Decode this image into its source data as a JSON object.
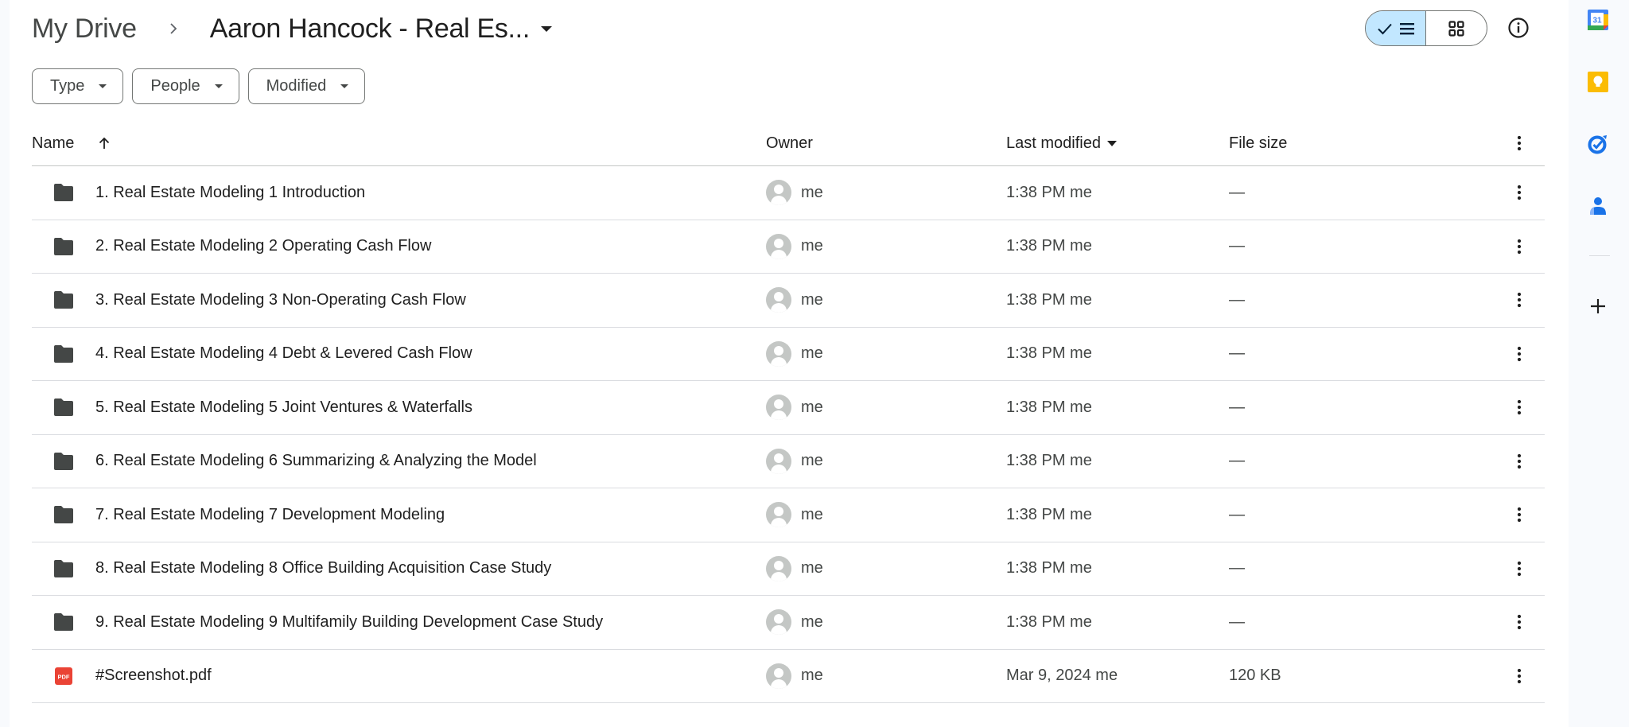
{
  "breadcrumb": {
    "root": "My Drive",
    "current": "Aaron Hancock - Real Es..."
  },
  "view_toggle": {
    "selected": "list",
    "options": [
      "list",
      "grid"
    ]
  },
  "filters": [
    {
      "label": "Type"
    },
    {
      "label": "People"
    },
    {
      "label": "Modified"
    }
  ],
  "table": {
    "columns": {
      "name": "Name",
      "owner": "Owner",
      "last_modified": "Last modified",
      "file_size": "File size"
    },
    "sort": {
      "column": "name",
      "direction": "ascending"
    },
    "rows": [
      {
        "type": "folder",
        "name": "1. Real Estate Modeling 1 Introduction",
        "owner": "me",
        "modified": "1:38 PM me",
        "size": "—"
      },
      {
        "type": "folder",
        "name": "2. Real Estate Modeling 2 Operating Cash Flow",
        "owner": "me",
        "modified": "1:38 PM me",
        "size": "—"
      },
      {
        "type": "folder",
        "name": "3. Real Estate Modeling 3 Non-Operating Cash Flow",
        "owner": "me",
        "modified": "1:38 PM me",
        "size": "—"
      },
      {
        "type": "folder",
        "name": "4. Real Estate Modeling 4 Debt & Levered Cash Flow",
        "owner": "me",
        "modified": "1:38 PM me",
        "size": "—"
      },
      {
        "type": "folder",
        "name": "5. Real Estate Modeling 5 Joint Ventures & Waterfalls",
        "owner": "me",
        "modified": "1:38 PM me",
        "size": "—"
      },
      {
        "type": "folder",
        "name": "6. Real Estate Modeling 6 Summarizing & Analyzing the Model",
        "owner": "me",
        "modified": "1:38 PM me",
        "size": "—"
      },
      {
        "type": "folder",
        "name": "7. Real Estate Modeling 7 Development Modeling",
        "owner": "me",
        "modified": "1:38 PM me",
        "size": "—"
      },
      {
        "type": "folder",
        "name": "8. Real Estate Modeling 8 Office Building Acquisition Case Study",
        "owner": "me",
        "modified": "1:38 PM me",
        "size": "—"
      },
      {
        "type": "folder",
        "name": "9. Real Estate Modeling 9 Multifamily Building Development Case Study",
        "owner": "me",
        "modified": "1:38 PM me",
        "size": "—"
      },
      {
        "type": "pdf",
        "name": "#Screenshot.pdf",
        "owner": "me",
        "modified": "Mar 9, 2024 me",
        "size": "120 KB"
      }
    ]
  },
  "side_panel": {
    "apps": [
      "calendar-icon",
      "keep-icon",
      "tasks-icon",
      "contacts-icon"
    ],
    "calendar_day": "31",
    "add_label": "+"
  },
  "colors": {
    "accent_selected": "#c2e7ff",
    "pdf_red": "#ea4335",
    "folder": "#444746"
  }
}
